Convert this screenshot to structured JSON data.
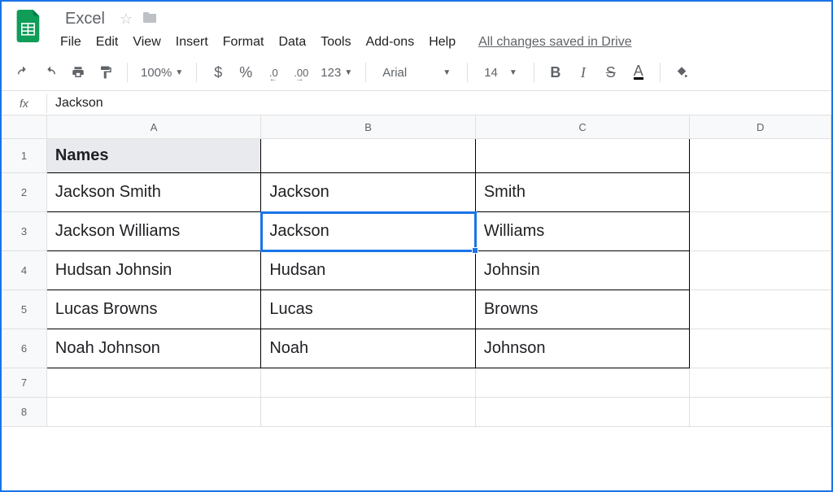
{
  "header": {
    "doc_title": "Excel",
    "menu": {
      "file": "File",
      "edit": "Edit",
      "view": "View",
      "insert": "Insert",
      "format": "Format",
      "data": "Data",
      "tools": "Tools",
      "addons": "Add-ons",
      "help": "Help"
    },
    "save_status": "All changes saved in Drive"
  },
  "toolbar": {
    "zoom": "100%",
    "currency": "$",
    "percent": "%",
    "dec_decrease": ".0",
    "dec_increase": ".00",
    "more_formats": "123",
    "font": "Arial",
    "font_size": "14",
    "bold": "B",
    "italic": "I",
    "strike": "S",
    "text_color": "A"
  },
  "formula_bar": {
    "fx": "fx",
    "value": "Jackson"
  },
  "columns": [
    "A",
    "B",
    "C",
    "D"
  ],
  "rows": [
    {
      "num": "1",
      "cells": [
        "Names",
        "",
        "",
        ""
      ]
    },
    {
      "num": "2",
      "cells": [
        "Jackson Smith",
        "Jackson",
        "Smith",
        ""
      ]
    },
    {
      "num": "3",
      "cells": [
        "Jackson Williams",
        "Jackson",
        "Williams",
        ""
      ]
    },
    {
      "num": "4",
      "cells": [
        "Hudsan Johnsin",
        "Hudsan",
        "Johnsin",
        ""
      ]
    },
    {
      "num": "5",
      "cells": [
        "Lucas Browns",
        "Lucas",
        "Browns",
        ""
      ]
    },
    {
      "num": "6",
      "cells": [
        "Noah Johnson",
        "Noah",
        "Johnson",
        ""
      ]
    },
    {
      "num": "7",
      "cells": [
        "",
        "",
        "",
        ""
      ]
    },
    {
      "num": "8",
      "cells": [
        "",
        "",
        "",
        ""
      ]
    }
  ],
  "active_cell": "B3"
}
